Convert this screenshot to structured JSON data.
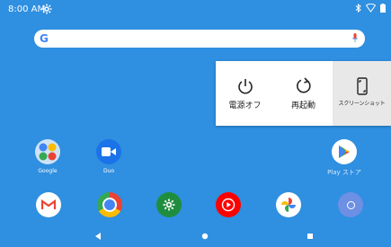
{
  "status_bar": {
    "time": "8:00 AM"
  },
  "search": {
    "g_logo": "G"
  },
  "power_menu": {
    "power_off": "電源オフ",
    "restart": "再起動",
    "screenshot": "スクリーンショット"
  },
  "home_apps": [
    {
      "label": "Google"
    },
    {
      "label": "Duo"
    },
    {
      "label": "Play ストア"
    }
  ],
  "dock": [
    "Gmail",
    "Chrome",
    "Settings",
    "YouTube Music",
    "Photos",
    "Circle app"
  ],
  "colors": {
    "wallpaper": "#2f8fe0",
    "gmail_red": "#ea4335",
    "settings_green": "#1e8e3e",
    "duo_blue": "#1a73e8",
    "youtube_red": "#ff0000"
  }
}
